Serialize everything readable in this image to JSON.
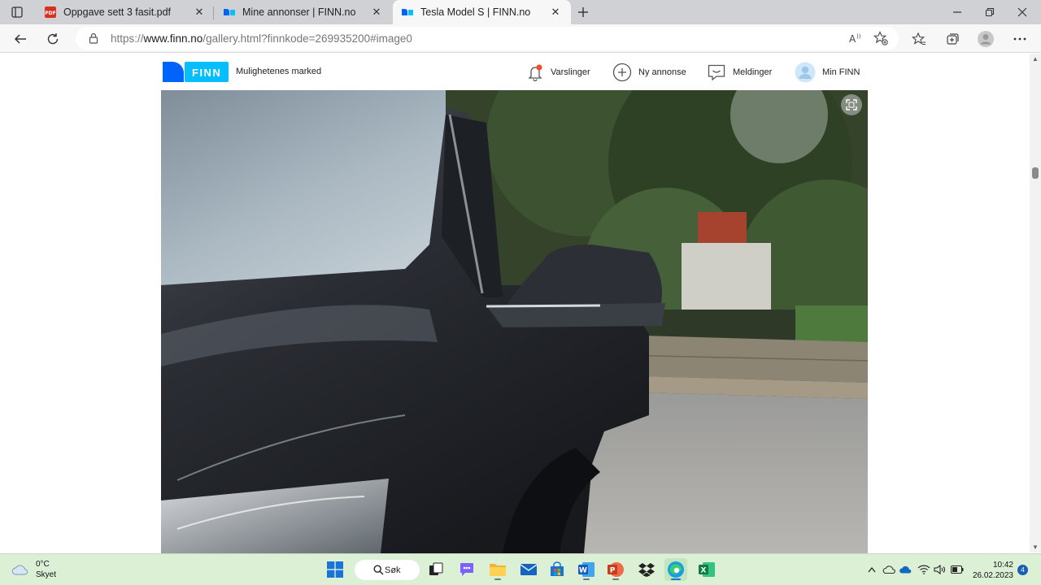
{
  "browser": {
    "tabs": [
      {
        "title": "Oppgave sett 3 fasit.pdf",
        "favicon": "pdf-icon",
        "active": false
      },
      {
        "title": "Mine annonser | FINN.no",
        "favicon": "finn-icon",
        "active": false
      },
      {
        "title": "Tesla Model S | FINN.no",
        "favicon": "finn-icon",
        "active": true
      }
    ],
    "address": {
      "prefix": "https://",
      "host": "www.finn.no",
      "path": "/gallery.html?finnkode=269935200#image0"
    }
  },
  "site": {
    "logo_text": "FINN",
    "tagline": "Mulighetenes marked",
    "nav": [
      {
        "label": "Varslinger",
        "icon": "bell-icon"
      },
      {
        "label": "Ny annonse",
        "icon": "plus-circle-icon"
      },
      {
        "label": "Meldinger",
        "icon": "chat-icon"
      },
      {
        "label": "Min FINN",
        "icon": "user-avatar-icon"
      }
    ],
    "brand_color": "#0063fb",
    "brand_accent": "#06befb"
  },
  "taskbar": {
    "weather_temp": "0°C",
    "weather_text": "Skyet",
    "search_label": "Søk",
    "time": "10:42",
    "date": "26.02.2023",
    "notification_count": "4"
  }
}
